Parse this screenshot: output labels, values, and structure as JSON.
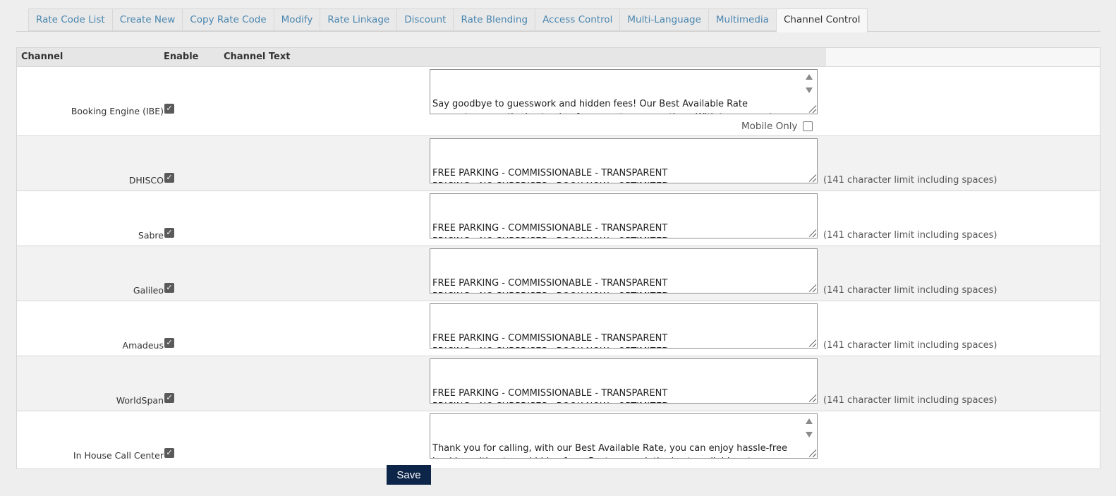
{
  "tabs": [
    {
      "label": "Rate Code List"
    },
    {
      "label": "Create New"
    },
    {
      "label": "Copy Rate Code"
    },
    {
      "label": "Modify"
    },
    {
      "label": "Rate Linkage"
    },
    {
      "label": "Discount"
    },
    {
      "label": "Rate Blending"
    },
    {
      "label": "Access Control"
    },
    {
      "label": "Multi-Language"
    },
    {
      "label": "Multimedia"
    },
    {
      "label": "Channel Control"
    }
  ],
  "table": {
    "headers": {
      "channel": "Channel",
      "enable": "Enable",
      "channel_text": "Channel Text"
    },
    "mobile_only_label": "Mobile Only",
    "limit_note": "(141 character limit including spaces)",
    "rows": [
      {
        "channel": "Booking Engine (IBE)",
        "enabled": true,
        "text": "Say goodbye to guesswork and hidden fees! Our Best Available Rate\nguarantees you the best value for your stay, every time. With transparent\npricing and no surprises, whether it's a spontaneous getaway or a planned"
      },
      {
        "channel": "DHISCO",
        "enabled": true,
        "text": "FREE PARKING - COMMISSIONABLE - TRANSPARENT\nPRICING - NO SURPRISES - BOOK NOW - OPTIMIZED\nFOR DHISCO CHANNELS"
      },
      {
        "channel": "Sabre",
        "enabled": true,
        "text": "FREE PARKING - COMMISSIONABLE - TRANSPARENT\nPRICING - NO SURPRISES - BOOK NOW - OPTIMIZED\nFOR SABRE CHANNEL"
      },
      {
        "channel": "Galileo",
        "enabled": true,
        "text": "FREE PARKING - COMMISSIONABLE - TRANSPARENT\nPRICING - NO SURPRISES - BOOK NOW - OPTIMIZED\nFOR GALILEO"
      },
      {
        "channel": "Amadeus",
        "enabled": true,
        "text": "FREE PARKING - COMMISSIONABLE - TRANSPARENT\nPRICING - NO SURPRISES - BOOK NOW - OPTIMIZED\nFOR AMADEUS"
      },
      {
        "channel": "WorldSpan",
        "enabled": true,
        "text": "FREE PARKING - COMMISSIONABLE - TRANSPARENT\nPRICING - NO SURPRISES - BOOK NOW - OPTIMIZED\nFOR WORLDSPAN"
      },
      {
        "channel": "In House Call Center",
        "enabled": true,
        "text": "Thank you for calling, with our Best Available Rate, you can enjoy hassle-free\nbooking without any hidden fees. Rest assured, the best available rate\nguarantees you the best value for your stay, whether you're planning a"
      }
    ]
  },
  "save_label": "Save"
}
